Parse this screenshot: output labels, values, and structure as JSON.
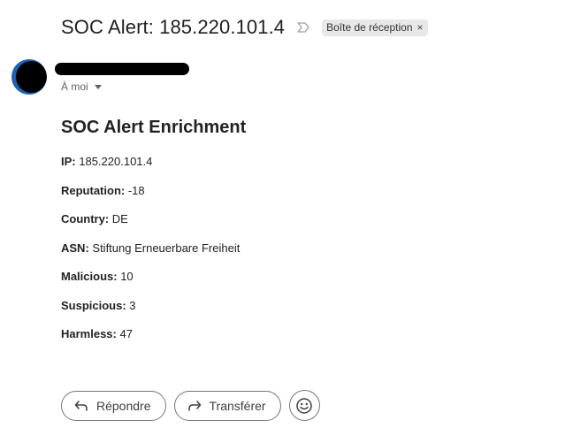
{
  "email": {
    "subject": "SOC Alert: 185.220.101.4",
    "label": "Boîte de réception",
    "label_close": "×",
    "recipient_text": "À moi"
  },
  "body": {
    "heading": "SOC Alert Enrichment",
    "fields": [
      {
        "label": "IP:",
        "value": " 185.220.101.4"
      },
      {
        "label": "Reputation:",
        "value": " -18"
      },
      {
        "label": "Country:",
        "value": " DE"
      },
      {
        "label": "ASN:",
        "value": " Stiftung Erneuerbare Freiheit"
      },
      {
        "label": "Malicious:",
        "value": " 10"
      },
      {
        "label": "Suspicious:",
        "value": " 3"
      },
      {
        "label": "Harmless:",
        "value": " 47"
      }
    ]
  },
  "actions": {
    "reply_label": "Répondre",
    "forward_label": "Transférer"
  },
  "icons": {
    "important": "important-marker-icon",
    "reply": "reply-arrow-icon",
    "forward": "forward-arrow-icon",
    "emoji": "emoji-smile-icon",
    "recipient_details": "chevron-down-icon"
  },
  "colors": {
    "avatar_ring": "#1c62b0",
    "label_chip_bg": "#e8e8e8",
    "button_border": "#747775"
  }
}
